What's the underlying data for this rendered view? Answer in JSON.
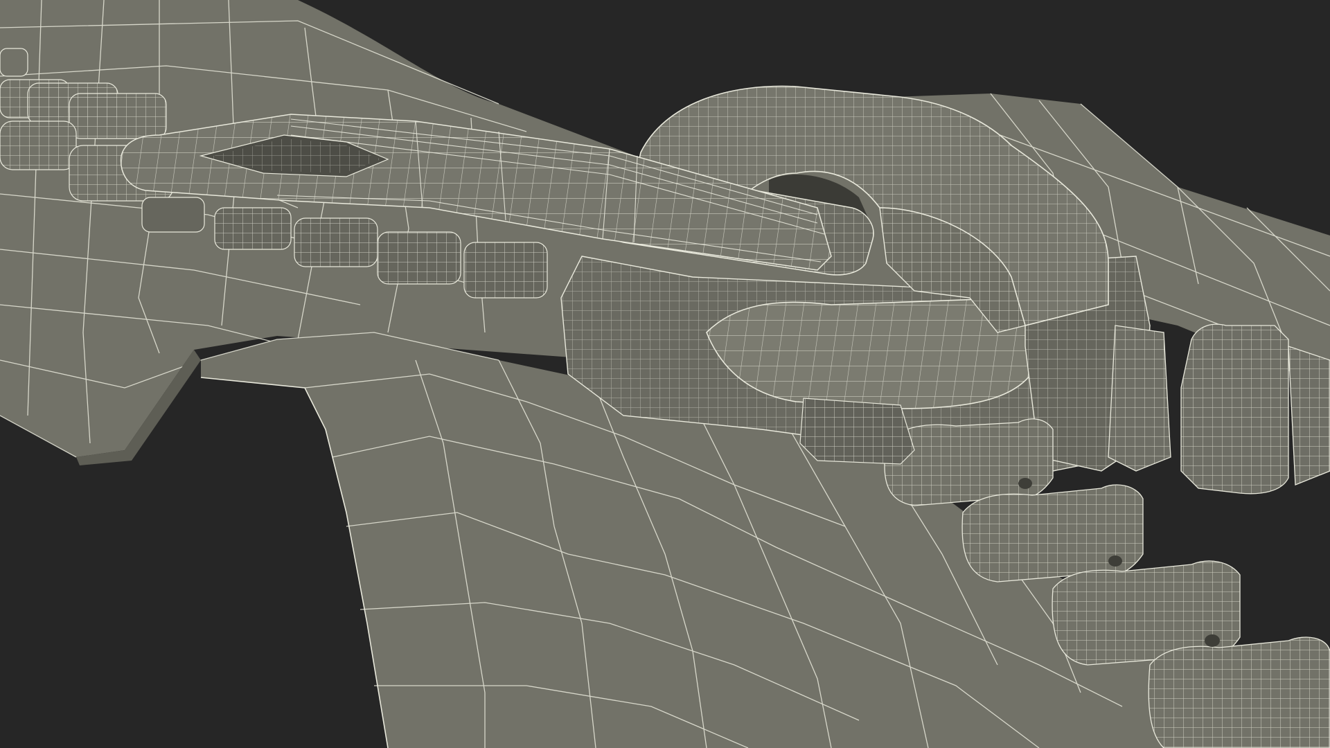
{
  "scene": {
    "subject": "zipper-slider-wireframe-render",
    "background_color": "#262626",
    "surface_color": "#727268",
    "surface_dark": "#5e5e55",
    "surface_light": "#85857a",
    "wire_color": "#e9e9dc"
  }
}
